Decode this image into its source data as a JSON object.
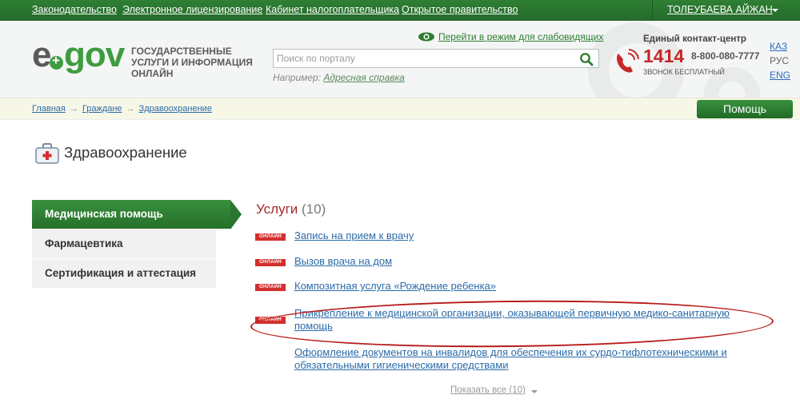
{
  "topbar": {
    "links": [
      "Законодательство",
      "Электронное лицензирование",
      "Кабинет налогоплательщика",
      "Открытое правительство"
    ],
    "user": "ТОЛЕУБАЕВА АЙЖАН"
  },
  "header": {
    "logo_prefix": "e",
    "logo_suffix": "gov",
    "tagline": "ГОСУДАРСТВЕННЫЕ УСЛУГИ И ИНФОРМАЦИЯ ОНЛАЙН",
    "low_vision": "Перейти в режим для слабовидящих",
    "search_placeholder": "Поиск по порталу",
    "example_label": "Например:",
    "example_link": "Адресная справка",
    "contact_title": "Единый контакт-центр",
    "contact_number": "1414",
    "contact_phone": "8-800-080-7777",
    "contact_free": "ЗВОНОК БЕСПЛАТНЫЙ",
    "langs": [
      "КАЗ",
      "РУС",
      "ENG"
    ]
  },
  "breadcrumb": {
    "items": [
      "Главная",
      "Граждане",
      "Здравоохранение"
    ],
    "separator": "→"
  },
  "help_label": "Помощь",
  "page_title": "Здравоохранение",
  "sidebar": {
    "items": [
      {
        "label": "Медицинская помощь"
      },
      {
        "label": "Фармацевтика"
      },
      {
        "label": "Сертификация и аттестация"
      }
    ]
  },
  "services": {
    "heading": "Услуги",
    "count": "(10)",
    "badge": "ОНЛАЙН",
    "items": [
      {
        "label": "Запись на прием к врачу"
      },
      {
        "label": "Вызов врача на дом"
      },
      {
        "label": "Композитная услуга «Рождение ребенка»"
      },
      {
        "label": "Прикрепление к медицинской организации, оказывающей первичную медико-санитарную помощь"
      },
      {
        "label": "Оформление документов на инвалидов для обеспечения их сурдо-тифлотехническими и обязательными гигиеническими средствами"
      }
    ],
    "show_all": "Показать все (10)"
  },
  "colors": {
    "brand_green": "#2e7d32",
    "link_blue": "#2b6ba8",
    "online_red": "#d32f2f",
    "highlight": "#b71c1c"
  }
}
